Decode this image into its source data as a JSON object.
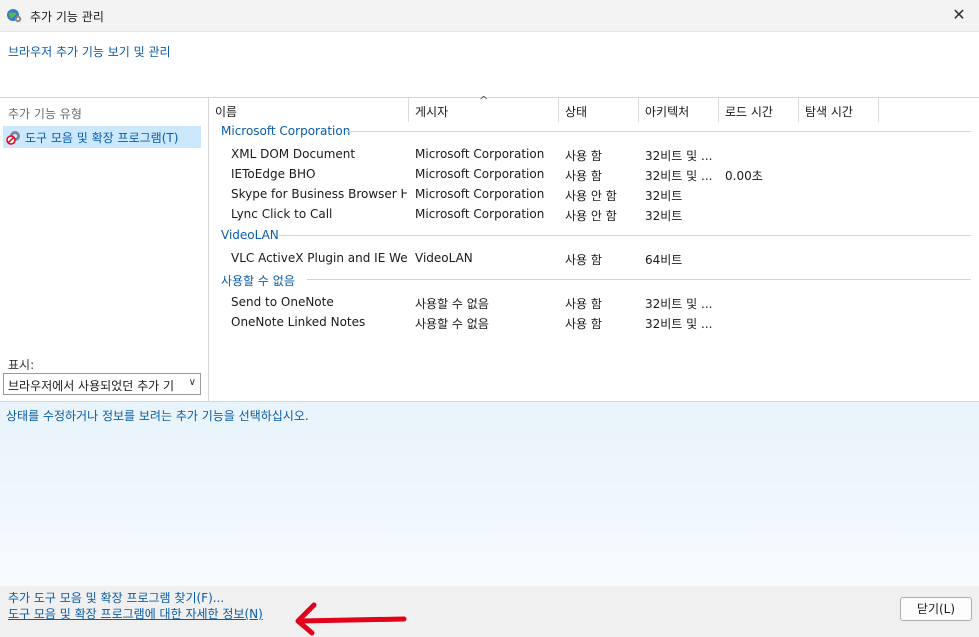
{
  "window": {
    "title": "추가 기능 관리"
  },
  "header": {
    "link": "브라우저 추가 기능 보기 및 관리"
  },
  "left": {
    "types_label": "추가 기능 유형",
    "types": [
      {
        "label": "도구 모음 및 확장 프로그램(T)",
        "selected": true
      }
    ],
    "show_label": "표시:",
    "show_value": "브라우저에서 사용되었던 추가 기능"
  },
  "table": {
    "columns": [
      "이름",
      "게시자",
      "상태",
      "아키텍처",
      "로드 시간",
      "탐색 시간"
    ],
    "groups": [
      {
        "name": "Microsoft Corporation",
        "rows": [
          {
            "name": "XML DOM Document",
            "publisher": "Microsoft Corporation",
            "status": "사용 함",
            "arch": "32비트 및 ...",
            "load": ""
          },
          {
            "name": "IEToEdge BHO",
            "publisher": "Microsoft Corporation",
            "status": "사용 함",
            "arch": "32비트 및 ...",
            "load": "0.00초"
          },
          {
            "name": "Skype for Business Browser He...",
            "publisher": "Microsoft Corporation",
            "status": "사용 안 함",
            "arch": "32비트",
            "load": ""
          },
          {
            "name": "Lync Click to Call",
            "publisher": "Microsoft Corporation",
            "status": "사용 안 함",
            "arch": "32비트",
            "load": ""
          }
        ]
      },
      {
        "name": "VideoLAN",
        "rows": [
          {
            "name": "VLC ActiveX Plugin and IE We...",
            "publisher": "VideoLAN",
            "status": "사용 함",
            "arch": "64비트",
            "load": ""
          }
        ]
      },
      {
        "name": "사용할 수 없음",
        "rows": [
          {
            "name": "Send to OneNote",
            "publisher": "사용할 수 없음",
            "status": "사용 함",
            "arch": "32비트 및 ...",
            "load": ""
          },
          {
            "name": "OneNote Linked Notes",
            "publisher": "사용할 수 없음",
            "status": "사용 함",
            "arch": "32비트 및 ...",
            "load": ""
          }
        ]
      }
    ]
  },
  "details": {
    "message": "상태를 수정하거나 정보를 보려는 추가 기능을 선택하십시오."
  },
  "footer": {
    "find_link": "추가 도구 모음 및 확장 프로그램 찾기(F)...",
    "learn_link": "도구 모음 및 확장 프로그램에 대한 자세한 정보(N)",
    "close_label": "닫기(L)"
  },
  "colors": {
    "link": "#0a5ca8",
    "selection": "#cce8ff",
    "annotation": "#e3001b"
  },
  "icons": {
    "app": "globe-gear-icon",
    "type": "gear-blocked-icon",
    "close": "close-icon",
    "sort": "sort-ascending-icon",
    "dropdown": "chevron-down-icon"
  }
}
